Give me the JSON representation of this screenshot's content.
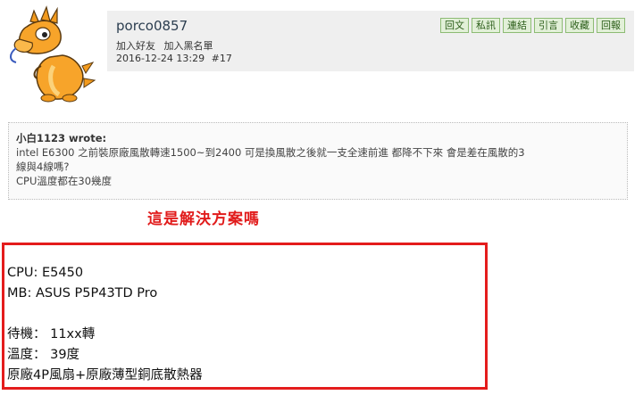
{
  "post": {
    "username": "porco0857",
    "user_links": [
      "加入好友",
      "加入黑名單"
    ],
    "timestamp": "2016-12-24 13:29",
    "post_number": "#17",
    "actions": [
      "回文",
      "私訊",
      "連結",
      "引言",
      "收藏",
      "回報"
    ]
  },
  "quote": {
    "author": "小白1123 wrote:",
    "lines": [
      "intel E6300 之前裝原廠風散轉速1500~到2400 可是換風散之後就一支全速前進 都降不下來 會是差在風散的3",
      "線與4線嗎?",
      "CPU溫度都在30幾度"
    ]
  },
  "reply_title": "這是解決方案嗎",
  "specs": {
    "lines_top": [
      "CPU: E5450",
      "MB: ASUS P5P43TD Pro"
    ],
    "lines_bottom": [
      "待機： 11xx轉",
      "溫度： 39度",
      "原廠4P風扇+原廠薄型銅底散熱器"
    ]
  },
  "colors": {
    "accent_red": "#e11b1b",
    "button_green": "#e2f0d8",
    "header_bg": "#efefef"
  },
  "icons": {
    "avatar": "dragon-avatar-icon"
  }
}
